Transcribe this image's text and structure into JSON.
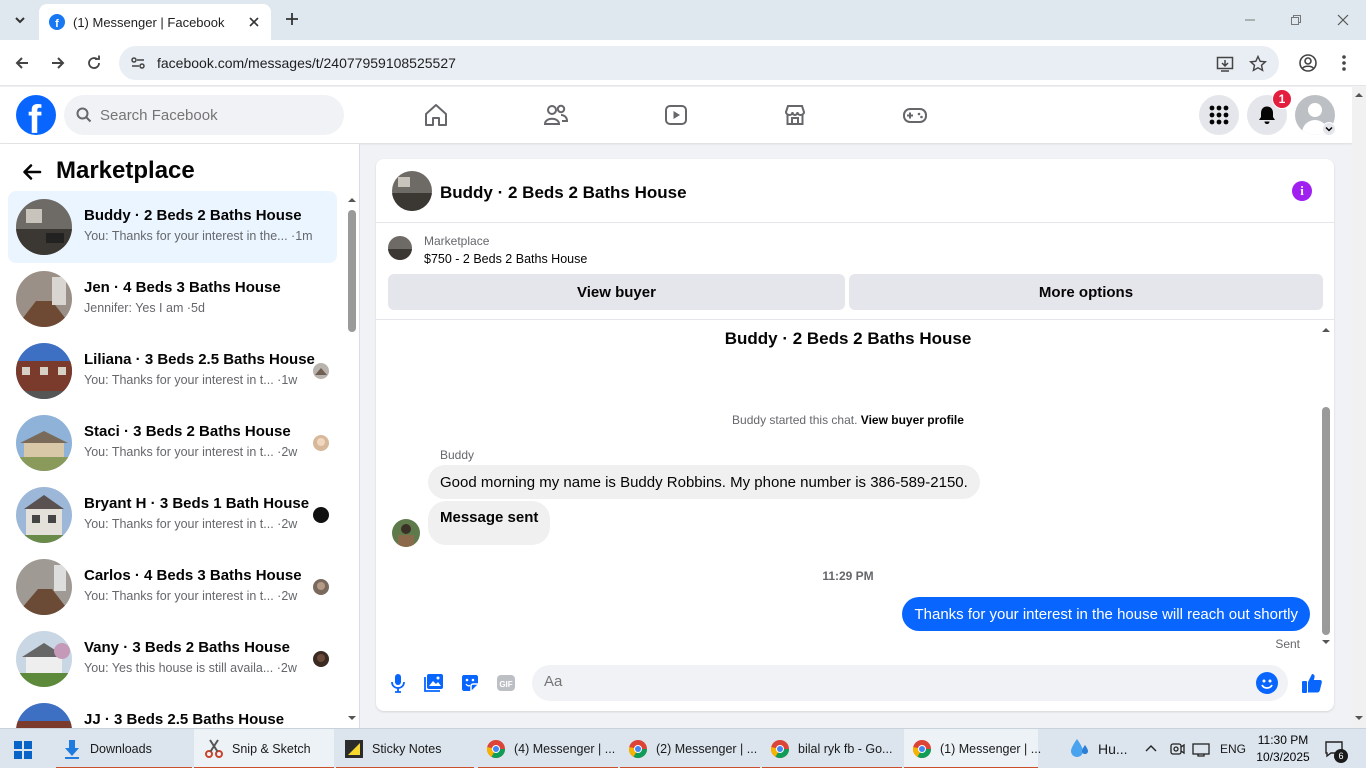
{
  "browser": {
    "tab_title": "(1) Messenger | Facebook",
    "url": "facebook.com/messages/t/24077959108525527"
  },
  "facebook": {
    "search_placeholder": "Search Facebook",
    "notification_count": "1",
    "brand_color": "#0866ff"
  },
  "sidebar": {
    "title": "Marketplace",
    "conversations": [
      {
        "name": "Buddy · 2 Beds 2 Baths House",
        "preview": "You: Thanks for your interest in the... ·1m",
        "active": true
      },
      {
        "name": "Jen · 4 Beds 3 Baths House",
        "preview": "Jennifer: Yes I am ·5d"
      },
      {
        "name": "Liliana · 3 Beds 2.5 Baths House",
        "preview": "You: Thanks for your interest in t... ·1w"
      },
      {
        "name": "Staci · 3 Beds 2 Baths House",
        "preview": "You: Thanks for your interest in t... ·2w"
      },
      {
        "name": "Bryant H · 3 Beds 1 Bath House",
        "preview": "You: Thanks for your interest in t... ·2w"
      },
      {
        "name": "Carlos · 4 Beds 3 Baths House",
        "preview": "You: Thanks for your interest in t... ·2w"
      },
      {
        "name": "Vany · 3 Beds 2 Baths House",
        "preview": "You: Yes this house is still availa... ·2w"
      },
      {
        "name": "JJ · 3 Beds 2.5 Baths House",
        "preview": ""
      }
    ]
  },
  "chat": {
    "title": "Buddy · 2 Beds 2 Baths House",
    "marketplace_label": "Marketplace",
    "listing": "$750 - 2 Beds 2 Baths House",
    "view_buyer": "View buyer",
    "more_options": "More options",
    "conversation_title": "Buddy · 2 Beds 2 Baths House",
    "started_text": "Buddy started this chat.",
    "view_profile": "View buyer profile",
    "sender": "Buddy",
    "incoming": [
      "Good morning my name is Buddy Robbins. My phone number is 386-589-2150.",
      "Message sent"
    ],
    "timestamp": "11:29 PM",
    "outgoing": "Thanks for your interest in the house will reach out shortly",
    "sent_status": "Sent",
    "composer_placeholder": "Aa"
  },
  "taskbar": {
    "items": [
      "Downloads",
      "Snip & Sketch",
      "Sticky Notes",
      "(4) Messenger | ...",
      "(2) Messenger | ...",
      "bilal ryk fb - Go...",
      "(1) Messenger | ..."
    ],
    "weather": "Hu...",
    "language": "ENG",
    "time": "11:30 PM",
    "date": "10/3/2025",
    "notif_count": "6"
  }
}
